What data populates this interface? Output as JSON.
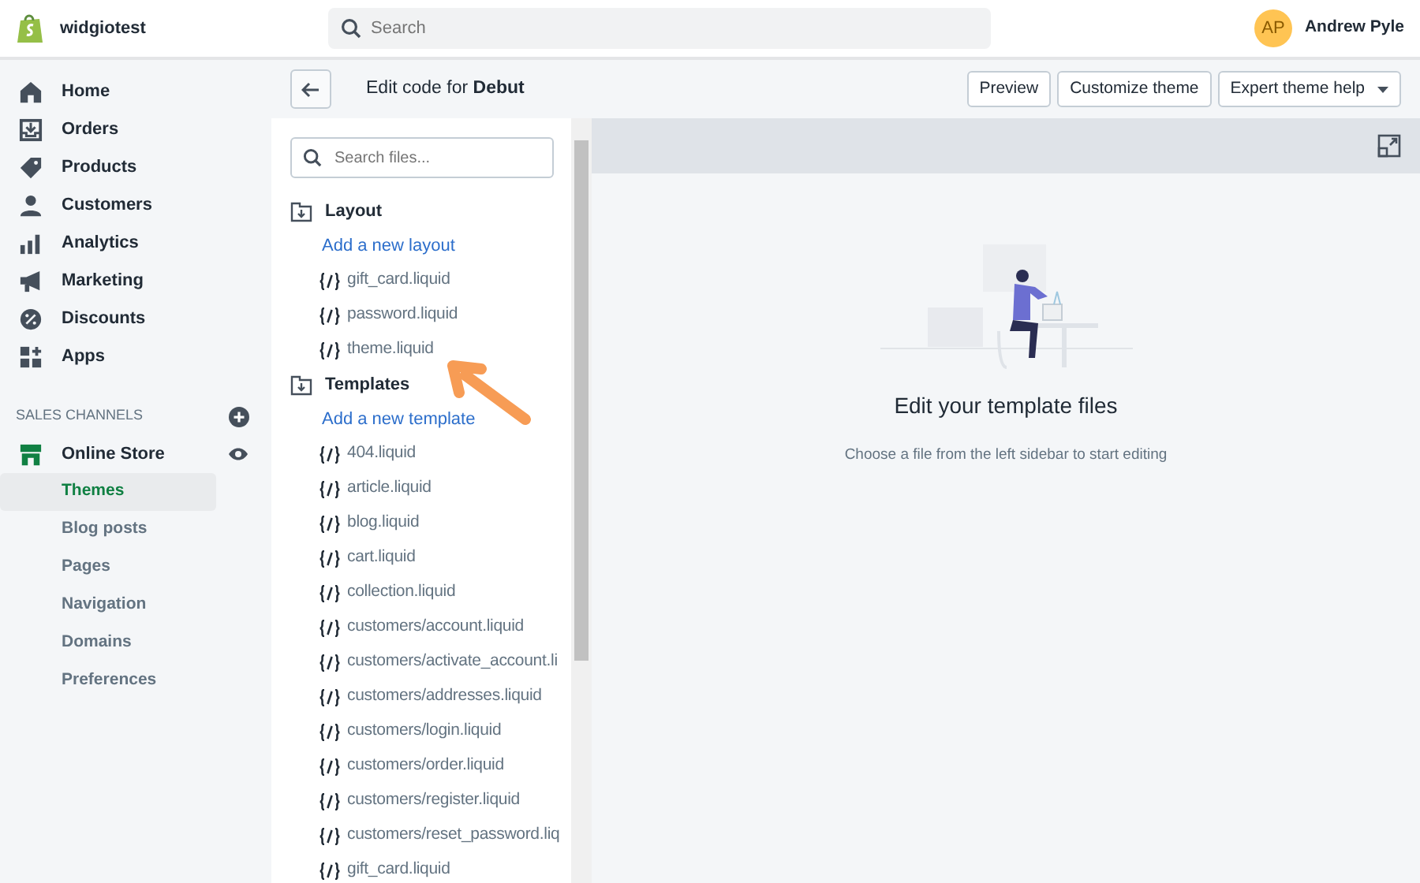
{
  "topbar": {
    "store_name": "widgiotest",
    "search": {
      "placeholder": "Search"
    },
    "user": {
      "initials": "AP",
      "name": "Andrew Pyle"
    }
  },
  "sidebar": {
    "items": [
      {
        "label": "Home"
      },
      {
        "label": "Orders"
      },
      {
        "label": "Products"
      },
      {
        "label": "Customers"
      },
      {
        "label": "Analytics"
      },
      {
        "label": "Marketing"
      },
      {
        "label": "Discounts"
      },
      {
        "label": "Apps"
      }
    ],
    "section_title": "SALES CHANNELS",
    "channel": {
      "label": "Online Store",
      "children": [
        {
          "label": "Themes",
          "selected": true
        },
        {
          "label": "Blog posts",
          "selected": false
        },
        {
          "label": "Pages",
          "selected": false
        },
        {
          "label": "Navigation",
          "selected": false
        },
        {
          "label": "Domains",
          "selected": false
        },
        {
          "label": "Preferences",
          "selected": false
        }
      ]
    }
  },
  "header": {
    "title": "Edit code for **Debut**",
    "buttons": [
      {
        "label": "Preview",
        "kind": "plain"
      },
      {
        "label": "Customize theme",
        "kind": "plain"
      },
      {
        "label": "Expert theme help",
        "kind": "dropdown"
      }
    ]
  },
  "files": {
    "search": {
      "placeholder": "Search files..."
    },
    "folders": [
      {
        "name": "Layout",
        "add_link": "Add a new layout",
        "files": [
          "gift_card.liquid",
          "password.liquid",
          "theme.liquid"
        ]
      },
      {
        "name": "Templates",
        "add_link": "Add a new template",
        "files": [
          "404.liquid",
          "article.liquid",
          "blog.liquid",
          "cart.liquid",
          "collection.liquid",
          "customers/account.liquid",
          "customers/activate_account.li",
          "customers/addresses.liquid",
          "customers/login.liquid",
          "customers/order.liquid",
          "customers/register.liquid",
          "customers/reset_password.liq",
          "gift_card.liquid"
        ]
      }
    ]
  },
  "editor": {
    "empty_title": "Edit your template files",
    "empty_text": "Choose a file from the left sidebar to start editing"
  }
}
